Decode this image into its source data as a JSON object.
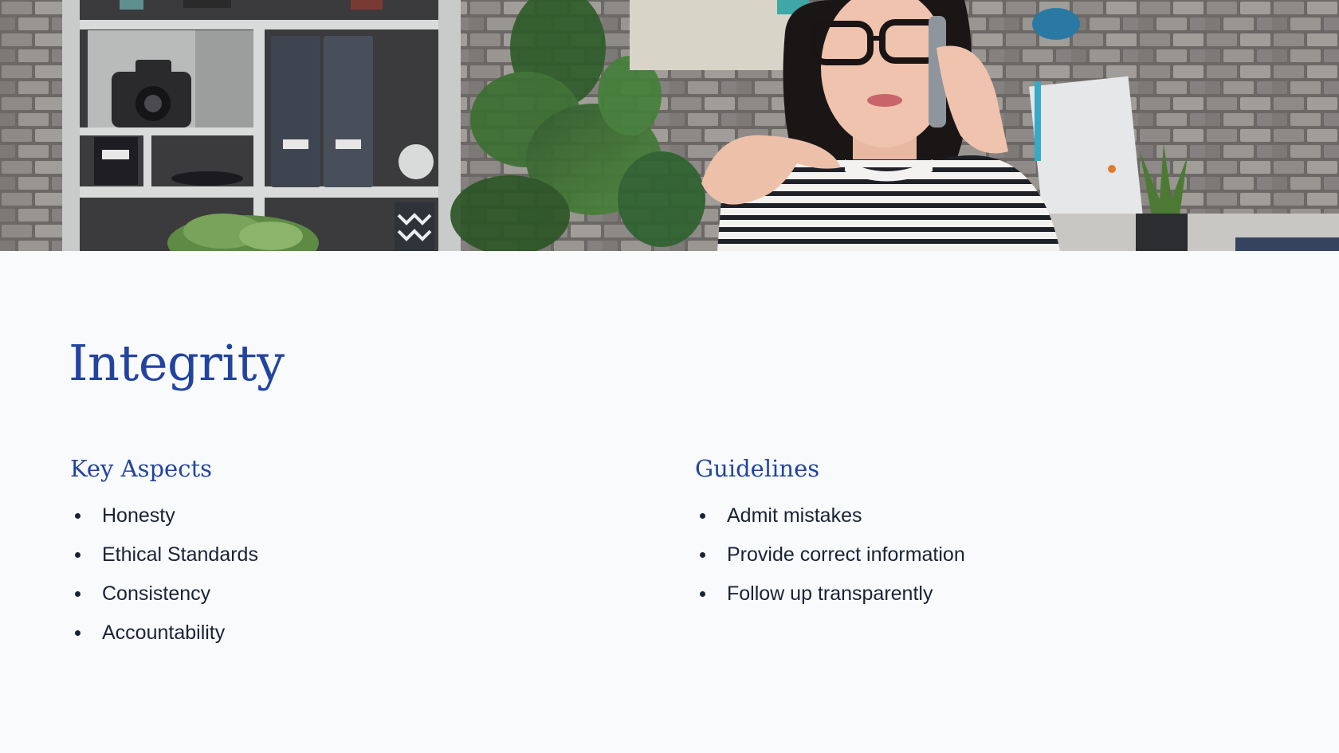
{
  "hero": {
    "image_name": "office-woman-on-phone-photo"
  },
  "slide": {
    "title": "Integrity"
  },
  "columns": {
    "left": {
      "heading": "Key Aspects",
      "items": [
        "Honesty",
        "Ethical Standards",
        "Consistency",
        "Accountability"
      ]
    },
    "right": {
      "heading": "Guidelines",
      "items": [
        "Admit mistakes",
        "Provide correct information",
        "Follow up transparently"
      ]
    }
  },
  "colors": {
    "accent": "#2244a0",
    "text": "#1a2236",
    "background": "#f9fafc"
  }
}
